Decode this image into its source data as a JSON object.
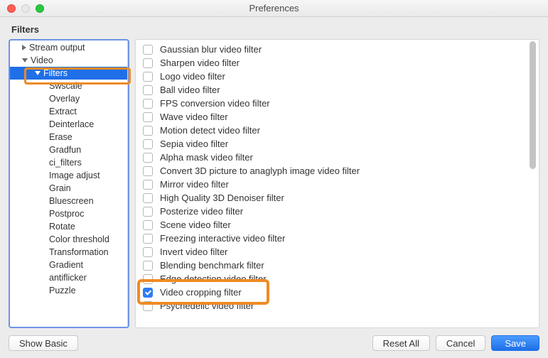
{
  "window": {
    "title": "Preferences"
  },
  "section_title": "Filters",
  "sidebar": {
    "items": [
      {
        "label": "Stream output",
        "level": 1,
        "disclosure": "right",
        "selected": false
      },
      {
        "label": "Video",
        "level": 1,
        "disclosure": "down",
        "selected": false
      },
      {
        "label": "Filters",
        "level": 2,
        "disclosure": "down",
        "selected": true
      },
      {
        "label": "Swscale",
        "level": 3
      },
      {
        "label": "Overlay",
        "level": 3
      },
      {
        "label": "Extract",
        "level": 3
      },
      {
        "label": "Deinterlace",
        "level": 3
      },
      {
        "label": "Erase",
        "level": 3
      },
      {
        "label": "Gradfun",
        "level": 3
      },
      {
        "label": "ci_filters",
        "level": 3
      },
      {
        "label": "Image adjust",
        "level": 3
      },
      {
        "label": "Grain",
        "level": 3
      },
      {
        "label": "Bluescreen",
        "level": 3
      },
      {
        "label": "Postproc",
        "level": 3
      },
      {
        "label": "Rotate",
        "level": 3
      },
      {
        "label": "Color threshold",
        "level": 3
      },
      {
        "label": "Transformation",
        "level": 3
      },
      {
        "label": "Gradient",
        "level": 3
      },
      {
        "label": "antiflicker",
        "level": 3
      },
      {
        "label": "Puzzle",
        "level": 3
      }
    ]
  },
  "filters": [
    {
      "label": "Gaussian blur video filter",
      "checked": false
    },
    {
      "label": "Sharpen video filter",
      "checked": false
    },
    {
      "label": "Logo video filter",
      "checked": false
    },
    {
      "label": "Ball video filter",
      "checked": false
    },
    {
      "label": "FPS conversion video filter",
      "checked": false
    },
    {
      "label": "Wave video filter",
      "checked": false
    },
    {
      "label": "Motion detect video filter",
      "checked": false
    },
    {
      "label": "Sepia video filter",
      "checked": false
    },
    {
      "label": "Alpha mask video filter",
      "checked": false
    },
    {
      "label": "Convert 3D picture to anaglyph image video filter",
      "checked": false
    },
    {
      "label": "Mirror video filter",
      "checked": false
    },
    {
      "label": "High Quality 3D Denoiser filter",
      "checked": false
    },
    {
      "label": "Posterize video filter",
      "checked": false
    },
    {
      "label": "Scene video filter",
      "checked": false
    },
    {
      "label": "Freezing interactive video filter",
      "checked": false
    },
    {
      "label": "Invert video filter",
      "checked": false
    },
    {
      "label": "Blending benchmark filter",
      "checked": false
    },
    {
      "label": "Edge detection video filter",
      "checked": false
    },
    {
      "label": "Video cropping filter",
      "checked": true
    },
    {
      "label": "Psychedelic video filter",
      "checked": false
    }
  ],
  "buttons": {
    "show_basic": "Show Basic",
    "reset_all": "Reset All",
    "cancel": "Cancel",
    "save": "Save"
  }
}
